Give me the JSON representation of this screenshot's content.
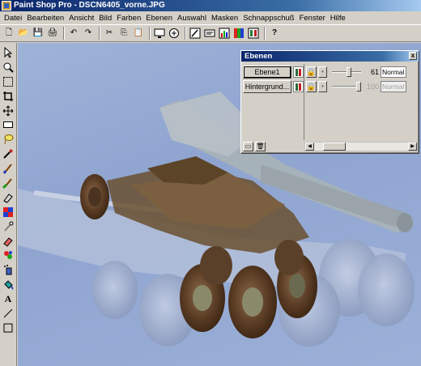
{
  "window": {
    "title": "Paint Shop Pro - DSCN6405_vorne.JPG"
  },
  "menu": [
    "Datei",
    "Bearbeiten",
    "Ansicht",
    "Bild",
    "Farben",
    "Ebenen",
    "Auswahl",
    "Masken",
    "Schnappschuß",
    "Fenster",
    "Hilfe"
  ],
  "toolbar": {
    "new": "🗋",
    "open": "📂",
    "save": "💾",
    "print": "🖨",
    "undo": "↶",
    "redo": "↷",
    "cut": "✂",
    "copy": "⎘",
    "paste": "📋",
    "help": "?"
  },
  "layers_palette": {
    "title": "Ebenen",
    "close": "x",
    "layers": [
      {
        "name": "Ebene1",
        "opacity": "61",
        "blend": "Normal",
        "opacity_fraction": 0.61,
        "active": true
      },
      {
        "name": "Hintergrund...",
        "opacity": "100",
        "blend": "Normal",
        "opacity_fraction": 1.0,
        "active": false
      }
    ]
  },
  "colors": {
    "titlebar_start": "#0a246a",
    "titlebar_end": "#a6caf0",
    "face": "#d4d0c8",
    "canvas_bg": "#9fb3d8"
  }
}
